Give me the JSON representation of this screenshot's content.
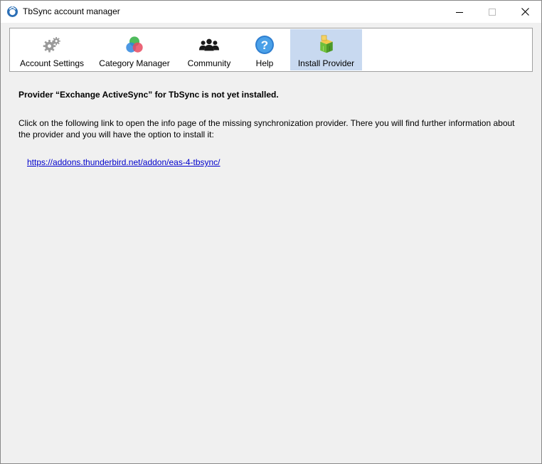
{
  "window": {
    "title": "TbSync account manager",
    "icons": {
      "app": "tbsync-app-icon",
      "minimize": "minimize-icon",
      "maximize": "maximize-icon",
      "close": "close-icon"
    }
  },
  "tabs": [
    {
      "label": "Account Settings",
      "icon": "gears-icon",
      "active": false
    },
    {
      "label": "Category Manager",
      "icon": "color-circles-icon",
      "active": false
    },
    {
      "label": "Community",
      "icon": "people-icon",
      "active": false
    },
    {
      "label": "Help",
      "icon": "question-icon",
      "active": false
    },
    {
      "label": "Install Provider",
      "icon": "package-icon",
      "active": true
    }
  ],
  "content": {
    "heading": "Provider “Exchange ActiveSync” for TbSync is not yet installed.",
    "description": "Click on the following link to open the info page of the missing synchronization provider. There you will find further information about the provider and you will have the option to install it:",
    "link": "https://addons.thunderbird.net/addon/eas-4-tbsync/"
  },
  "colors": {
    "active_tab": "#c8d9f0",
    "link": "#0000cc",
    "background": "#f0f0f0"
  }
}
